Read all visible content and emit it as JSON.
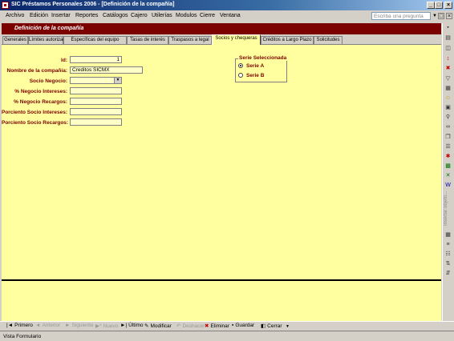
{
  "window": {
    "title": "SIC Préstamos Personales 2006 - [Definición de la compañía]"
  },
  "menu": {
    "items": [
      "Archivo",
      "Edición",
      "Insertar",
      "Reportes",
      "Catálogos",
      "Cajero",
      "Utilerías",
      "Modulos",
      "Cierre",
      "Ventana"
    ],
    "help_placeholder": "Escriba una pregunta"
  },
  "form": {
    "header": "Definición de la compañía",
    "tabs": [
      "Generales",
      "Límites autorizados",
      "Específicas del equipo",
      "Tasas de interés",
      "Traspasos a legal",
      "Socios y chequeras",
      "Créditos a Largo Plazo",
      "Solicitudes"
    ],
    "active_tab": "Socios y chequeras",
    "fields": {
      "id_label": "Id:",
      "id_value": "1",
      "company_label": "Nombre de la compañía:",
      "company_value": "Creditos SICMX",
      "socio_label": "Socio Negocio:",
      "socio_value": "",
      "pct_interest_label": "% Negocio Intereses:",
      "pct_interest_value": "",
      "pct_surcharge_label": "% Negocio Recargos:",
      "pct_surcharge_value": "",
      "socio_interest_label": "Porciento Socio Intereses:",
      "socio_interest_value": "",
      "socio_surcharge_label": "Porciento Socio Recargos:",
      "socio_surcharge_value": ""
    },
    "series": {
      "title": "Serie Seleccionada",
      "options": [
        "Serie A",
        "Serie B"
      ],
      "selected": "Serie A"
    }
  },
  "right_toolbar": {
    "insert_object_label": "Insertar objeto..."
  },
  "nav": {
    "first": "Primero",
    "previous": "Anterior",
    "next": "Siguiente",
    "new": "Nuevo",
    "last": "Último",
    "modify": "Modificar",
    "undo": "Deshacer",
    "delete": "Eliminar",
    "save": "Guardar",
    "close": "Cerrar"
  },
  "status": {
    "text": "Vista Formulario"
  },
  "colors": {
    "header_bg": "#7b0000",
    "form_bg": "#ffffa0",
    "label_color": "#7b0000"
  }
}
